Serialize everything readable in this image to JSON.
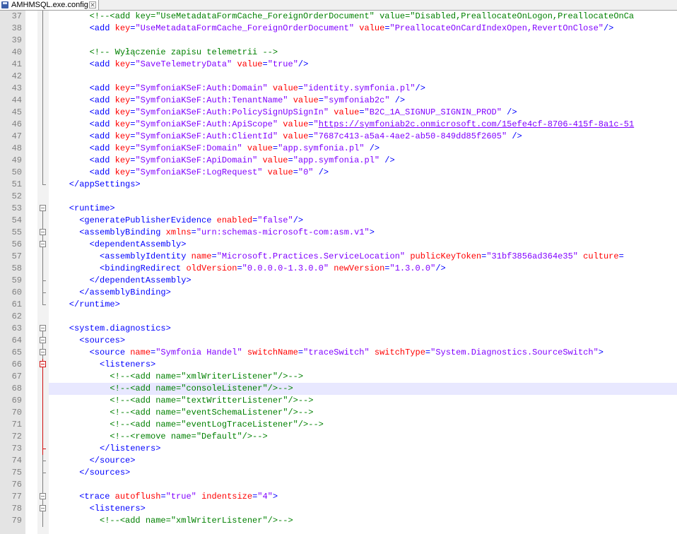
{
  "tab": {
    "label": "AMHMSQL.exe.config",
    "close_glyph": "✕"
  },
  "colors": {
    "tag": "#0000ff",
    "attribute": "#ff0000",
    "value": "#8000ff",
    "comment": "#008000",
    "current_line": "#e8e8ff"
  },
  "editor": {
    "highlighted_line": "68",
    "lines": [
      {
        "n": "37",
        "fold": "line",
        "segs": [
          {
            "t": "cmt",
            "v": "        <!--<add key=\"UseMetadataFormCache_ForeignOrderDocument\" value=\"Disabled,PreallocateOnLogon,PreallocateOnCa"
          }
        ]
      },
      {
        "n": "38",
        "fold": "line",
        "segs": [
          {
            "t": "tag",
            "v": "        <add "
          },
          {
            "t": "attr",
            "v": "key"
          },
          {
            "t": "tag",
            "v": "="
          },
          {
            "t": "val",
            "v": "\"UseMetadataFormCache_ForeignOrderDocument\""
          },
          {
            "t": "tag",
            "v": " "
          },
          {
            "t": "attr",
            "v": "value"
          },
          {
            "t": "tag",
            "v": "="
          },
          {
            "t": "val",
            "v": "\"PreallocateOnCardIndexOpen,RevertOnClose\""
          },
          {
            "t": "tag",
            "v": "/>"
          }
        ]
      },
      {
        "n": "39",
        "fold": "line",
        "segs": []
      },
      {
        "n": "40",
        "fold": "line",
        "segs": [
          {
            "t": "cmt",
            "v": "        <!-- Wyłączenie zapisu telemetrii -->"
          }
        ]
      },
      {
        "n": "41",
        "fold": "line",
        "segs": [
          {
            "t": "tag",
            "v": "        <add "
          },
          {
            "t": "attr",
            "v": "key"
          },
          {
            "t": "tag",
            "v": "="
          },
          {
            "t": "val",
            "v": "\"SaveTelemetryData\""
          },
          {
            "t": "tag",
            "v": " "
          },
          {
            "t": "attr",
            "v": "value"
          },
          {
            "t": "tag",
            "v": "="
          },
          {
            "t": "val",
            "v": "\"true\""
          },
          {
            "t": "tag",
            "v": "/>"
          }
        ]
      },
      {
        "n": "42",
        "fold": "line",
        "segs": []
      },
      {
        "n": "43",
        "fold": "line",
        "segs": [
          {
            "t": "tag",
            "v": "        <add "
          },
          {
            "t": "attr",
            "v": "key"
          },
          {
            "t": "tag",
            "v": "="
          },
          {
            "t": "val",
            "v": "\"SymfoniaKSeF:Auth:Domain\""
          },
          {
            "t": "tag",
            "v": " "
          },
          {
            "t": "attr",
            "v": "value"
          },
          {
            "t": "tag",
            "v": "="
          },
          {
            "t": "val",
            "v": "\"identity.symfonia.pl\""
          },
          {
            "t": "tag",
            "v": "/>"
          }
        ]
      },
      {
        "n": "44",
        "fold": "line",
        "segs": [
          {
            "t": "tag",
            "v": "        <add "
          },
          {
            "t": "attr",
            "v": "key"
          },
          {
            "t": "tag",
            "v": "="
          },
          {
            "t": "val",
            "v": "\"SymfoniaKSeF:Auth:TenantName\""
          },
          {
            "t": "tag",
            "v": " "
          },
          {
            "t": "attr",
            "v": "value"
          },
          {
            "t": "tag",
            "v": "="
          },
          {
            "t": "val",
            "v": "\"symfoniab2c\""
          },
          {
            "t": "tag",
            "v": " />"
          }
        ]
      },
      {
        "n": "45",
        "fold": "line",
        "segs": [
          {
            "t": "tag",
            "v": "        <add "
          },
          {
            "t": "attr",
            "v": "key"
          },
          {
            "t": "tag",
            "v": "="
          },
          {
            "t": "val",
            "v": "\"SymfoniaKSeF:Auth:PolicySignUpSignIn\""
          },
          {
            "t": "tag",
            "v": " "
          },
          {
            "t": "attr",
            "v": "value"
          },
          {
            "t": "tag",
            "v": "="
          },
          {
            "t": "val",
            "v": "\"B2C_1A_SIGNUP_SIGNIN_PROD\""
          },
          {
            "t": "tag",
            "v": " />"
          }
        ]
      },
      {
        "n": "46",
        "fold": "line",
        "segs": [
          {
            "t": "tag",
            "v": "        <add "
          },
          {
            "t": "attr",
            "v": "key"
          },
          {
            "t": "tag",
            "v": "="
          },
          {
            "t": "val",
            "v": "\"SymfoniaKSeF:Auth:ApiScope\""
          },
          {
            "t": "tag",
            "v": " "
          },
          {
            "t": "attr",
            "v": "value"
          },
          {
            "t": "tag",
            "v": "="
          },
          {
            "t": "val",
            "v": "\""
          },
          {
            "t": "url",
            "v": "https://symfoniab2c.onmicrosoft.com/15efe4cf-8706-415f-8a1c-51"
          }
        ]
      },
      {
        "n": "47",
        "fold": "line",
        "segs": [
          {
            "t": "tag",
            "v": "        <add "
          },
          {
            "t": "attr",
            "v": "key"
          },
          {
            "t": "tag",
            "v": "="
          },
          {
            "t": "val",
            "v": "\"SymfoniaKSeF:Auth:ClientId\""
          },
          {
            "t": "tag",
            "v": " "
          },
          {
            "t": "attr",
            "v": "value"
          },
          {
            "t": "tag",
            "v": "="
          },
          {
            "t": "val",
            "v": "\"7687c413-a5a4-4ae2-ab50-849dd85f2605\""
          },
          {
            "t": "tag",
            "v": " />"
          }
        ]
      },
      {
        "n": "48",
        "fold": "line",
        "segs": [
          {
            "t": "tag",
            "v": "        <add "
          },
          {
            "t": "attr",
            "v": "key"
          },
          {
            "t": "tag",
            "v": "="
          },
          {
            "t": "val",
            "v": "\"SymfoniaKSeF:Domain\""
          },
          {
            "t": "tag",
            "v": " "
          },
          {
            "t": "attr",
            "v": "value"
          },
          {
            "t": "tag",
            "v": "="
          },
          {
            "t": "val",
            "v": "\"app.symfonia.pl\""
          },
          {
            "t": "tag",
            "v": " />"
          }
        ]
      },
      {
        "n": "49",
        "fold": "line",
        "segs": [
          {
            "t": "tag",
            "v": "        <add "
          },
          {
            "t": "attr",
            "v": "key"
          },
          {
            "t": "tag",
            "v": "="
          },
          {
            "t": "val",
            "v": "\"SymfoniaKSeF:ApiDomain\""
          },
          {
            "t": "tag",
            "v": " "
          },
          {
            "t": "attr",
            "v": "value"
          },
          {
            "t": "tag",
            "v": "="
          },
          {
            "t": "val",
            "v": "\"app.symfonia.pl\""
          },
          {
            "t": "tag",
            "v": " />"
          }
        ]
      },
      {
        "n": "50",
        "fold": "line",
        "segs": [
          {
            "t": "tag",
            "v": "        <add "
          },
          {
            "t": "attr",
            "v": "key"
          },
          {
            "t": "tag",
            "v": "="
          },
          {
            "t": "val",
            "v": "\"SymfoniaKSeF:LogRequest\""
          },
          {
            "t": "tag",
            "v": " "
          },
          {
            "t": "attr",
            "v": "value"
          },
          {
            "t": "tag",
            "v": "="
          },
          {
            "t": "val",
            "v": "\"0\""
          },
          {
            "t": "tag",
            "v": " />"
          }
        ]
      },
      {
        "n": "51",
        "fold": "end",
        "segs": [
          {
            "t": "tag",
            "v": "    </appSettings>"
          }
        ]
      },
      {
        "n": "52",
        "fold": "none",
        "segs": []
      },
      {
        "n": "53",
        "fold": "open",
        "segs": [
          {
            "t": "tag",
            "v": "    <runtime>"
          }
        ]
      },
      {
        "n": "54",
        "fold": "line",
        "segs": [
          {
            "t": "tag",
            "v": "      <generatePublisherEvidence "
          },
          {
            "t": "attr",
            "v": "enabled"
          },
          {
            "t": "tag",
            "v": "="
          },
          {
            "t": "val",
            "v": "\"false\""
          },
          {
            "t": "tag",
            "v": "/>"
          }
        ]
      },
      {
        "n": "55",
        "fold": "open",
        "segs": [
          {
            "t": "tag",
            "v": "      <assemblyBinding "
          },
          {
            "t": "attr",
            "v": "xmlns"
          },
          {
            "t": "tag",
            "v": "="
          },
          {
            "t": "val",
            "v": "\"urn:schemas-microsoft-com:asm.v1\""
          },
          {
            "t": "tag",
            "v": ">"
          }
        ]
      },
      {
        "n": "56",
        "fold": "open",
        "segs": [
          {
            "t": "tag",
            "v": "        <dependentAssembly>"
          }
        ]
      },
      {
        "n": "57",
        "fold": "line",
        "segs": [
          {
            "t": "tag",
            "v": "          <assemblyIdentity "
          },
          {
            "t": "attr",
            "v": "name"
          },
          {
            "t": "tag",
            "v": "="
          },
          {
            "t": "val",
            "v": "\"Microsoft.Practices.ServiceLocation\""
          },
          {
            "t": "tag",
            "v": " "
          },
          {
            "t": "attr",
            "v": "publicKeyToken"
          },
          {
            "t": "tag",
            "v": "="
          },
          {
            "t": "val",
            "v": "\"31bf3856ad364e35\""
          },
          {
            "t": "tag",
            "v": " "
          },
          {
            "t": "attr",
            "v": "culture"
          },
          {
            "t": "tag",
            "v": "="
          }
        ]
      },
      {
        "n": "58",
        "fold": "line",
        "segs": [
          {
            "t": "tag",
            "v": "          <bindingRedirect "
          },
          {
            "t": "attr",
            "v": "oldVersion"
          },
          {
            "t": "tag",
            "v": "="
          },
          {
            "t": "val",
            "v": "\"0.0.0.0-1.3.0.0\""
          },
          {
            "t": "tag",
            "v": " "
          },
          {
            "t": "attr",
            "v": "newVersion"
          },
          {
            "t": "tag",
            "v": "="
          },
          {
            "t": "val",
            "v": "\"1.3.0.0\""
          },
          {
            "t": "tag",
            "v": "/>"
          }
        ]
      },
      {
        "n": "59",
        "fold": "end",
        "segs": [
          {
            "t": "tag",
            "v": "        </dependentAssembly>"
          }
        ]
      },
      {
        "n": "60",
        "fold": "end",
        "segs": [
          {
            "t": "tag",
            "v": "      </assemblyBinding>"
          }
        ]
      },
      {
        "n": "61",
        "fold": "end",
        "segs": [
          {
            "t": "tag",
            "v": "    </runtime>"
          }
        ]
      },
      {
        "n": "62",
        "fold": "none",
        "segs": []
      },
      {
        "n": "63",
        "fold": "open",
        "segs": [
          {
            "t": "tag",
            "v": "    <system.diagnostics>"
          }
        ]
      },
      {
        "n": "64",
        "fold": "open",
        "segs": [
          {
            "t": "tag",
            "v": "      <sources>"
          }
        ]
      },
      {
        "n": "65",
        "fold": "open",
        "segs": [
          {
            "t": "tag",
            "v": "        <source "
          },
          {
            "t": "attr",
            "v": "name"
          },
          {
            "t": "tag",
            "v": "="
          },
          {
            "t": "val",
            "v": "\"Symfonia Handel\""
          },
          {
            "t": "tag",
            "v": " "
          },
          {
            "t": "attr",
            "v": "switchName"
          },
          {
            "t": "tag",
            "v": "="
          },
          {
            "t": "val",
            "v": "\"traceSwitch\""
          },
          {
            "t": "tag",
            "v": " "
          },
          {
            "t": "attr",
            "v": "switchType"
          },
          {
            "t": "tag",
            "v": "="
          },
          {
            "t": "val",
            "v": "\"System.Diagnostics.SourceSwitch\""
          },
          {
            "t": "tag",
            "v": ">"
          }
        ]
      },
      {
        "n": "66",
        "fold": "open-red",
        "segs": [
          {
            "t": "tag",
            "v": "          <listeners>"
          }
        ]
      },
      {
        "n": "67",
        "fold": "line-red",
        "segs": [
          {
            "t": "cmt",
            "v": "            <!--<add name=\"xmlWriterListener\"/>-->"
          }
        ]
      },
      {
        "n": "68",
        "fold": "line-red",
        "segs": [
          {
            "t": "cmt",
            "v": "            <!--<add name=\"consoleListener\"/>-->"
          }
        ]
      },
      {
        "n": "69",
        "fold": "line-red",
        "segs": [
          {
            "t": "cmt",
            "v": "            <!--<add name=\"textWritterListener\"/>-->"
          }
        ]
      },
      {
        "n": "70",
        "fold": "line-red",
        "segs": [
          {
            "t": "cmt",
            "v": "            <!--<add name=\"eventSchemaListener\"/>-->"
          }
        ]
      },
      {
        "n": "71",
        "fold": "line-red",
        "segs": [
          {
            "t": "cmt",
            "v": "            <!--<add name=\"eventLogTraceListener\"/>-->"
          }
        ]
      },
      {
        "n": "72",
        "fold": "line-red",
        "segs": [
          {
            "t": "cmt",
            "v": "            <!--<remove name=\"Default\"/>-->"
          }
        ]
      },
      {
        "n": "73",
        "fold": "end-red",
        "segs": [
          {
            "t": "tag",
            "v": "          </listeners>"
          }
        ]
      },
      {
        "n": "74",
        "fold": "end",
        "segs": [
          {
            "t": "tag",
            "v": "        </source>"
          }
        ]
      },
      {
        "n": "75",
        "fold": "end",
        "segs": [
          {
            "t": "tag",
            "v": "      </sources>"
          }
        ]
      },
      {
        "n": "76",
        "fold": "line",
        "segs": []
      },
      {
        "n": "77",
        "fold": "open",
        "segs": [
          {
            "t": "tag",
            "v": "      <trace "
          },
          {
            "t": "attr",
            "v": "autoflush"
          },
          {
            "t": "tag",
            "v": "="
          },
          {
            "t": "val",
            "v": "\"true\""
          },
          {
            "t": "tag",
            "v": " "
          },
          {
            "t": "attr",
            "v": "indentsize"
          },
          {
            "t": "tag",
            "v": "="
          },
          {
            "t": "val",
            "v": "\"4\""
          },
          {
            "t": "tag",
            "v": ">"
          }
        ]
      },
      {
        "n": "78",
        "fold": "open",
        "segs": [
          {
            "t": "tag",
            "v": "        <listeners>"
          }
        ]
      },
      {
        "n": "79",
        "fold": "line",
        "segs": [
          {
            "t": "cmt",
            "v": "          <!--<add name=\"xmlWriterListener\"/>-->"
          }
        ]
      }
    ]
  }
}
